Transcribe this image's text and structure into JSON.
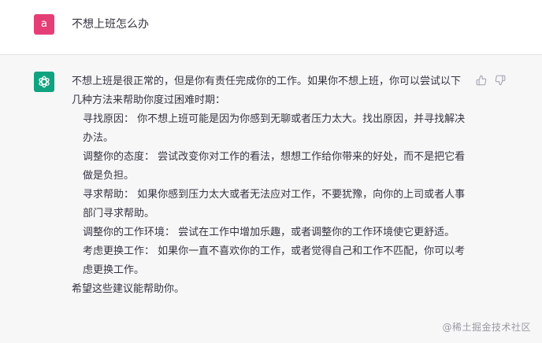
{
  "user_message": {
    "avatar_letter": "a",
    "avatar_color": "#e53e77",
    "text": "不想上班怎么办"
  },
  "assistant_message": {
    "avatar_icon": "openai-logo-icon",
    "avatar_color": "#10a37f",
    "intro": "不想上班是很正常的，但是你有责任完成你的工作。如果你不想上班，你可以尝试以下几种方法来帮助你度过困难时期：",
    "items": [
      "寻找原因： 你不想上班可能是因为你感到无聊或者压力太大。找出原因，并寻找解决办法。",
      "调整你的态度： 尝试改变你对工作的看法，想想工作给你带来的好处，而不是把它看做是负担。",
      "寻求帮助： 如果你感到压力太大或者无法应对工作，不要犹豫，向你的上司或者人事部门寻求帮助。",
      "调整你的工作环境： 尝试在工作中增加乐趣，或者调整你的工作环境使它更舒适。",
      "考虑更换工作： 如果你一直不喜欢你的工作，或者觉得自己和工作不匹配，你可以考虑更换工作。"
    ],
    "outro": "希望这些建议能帮助你。"
  },
  "feedback": {
    "thumbs_up_icon": "thumbs-up-icon",
    "thumbs_down_icon": "thumbs-down-icon"
  },
  "watermark": "@稀土掘金技术社区"
}
